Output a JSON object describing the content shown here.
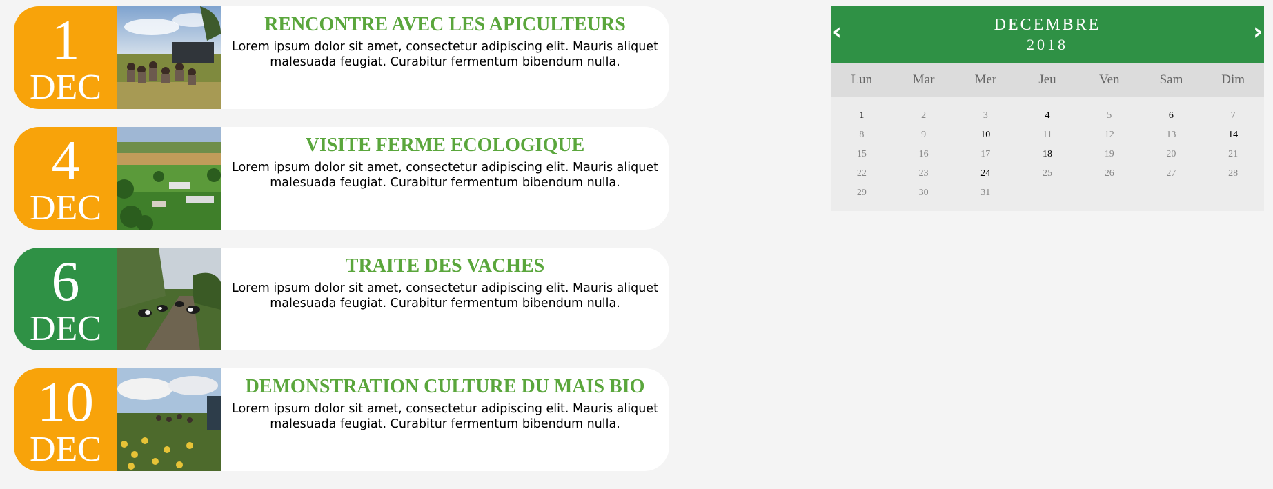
{
  "events": [
    {
      "day": "1",
      "month": "DEC",
      "badge_color": "orange",
      "title": "RENCONTRE AVEC LES APICULTEURS",
      "description": "Lorem ipsum dolor sit amet, consectetur adipiscing elit. Mauris aliquet malesuada feugiat. Curabitur fermentum bibendum nulla."
    },
    {
      "day": "4",
      "month": "DEC",
      "badge_color": "orange",
      "title": "VISITE FERME ECOLOGIQUE",
      "description": "Lorem ipsum dolor sit amet, consectetur adipiscing elit. Mauris aliquet malesuada feugiat. Curabitur fermentum bibendum nulla."
    },
    {
      "day": "6",
      "month": "DEC",
      "badge_color": "green",
      "title": "TRAITE DES VACHES",
      "description": "Lorem ipsum dolor sit amet, consectetur adipiscing elit. Mauris aliquet malesuada feugiat. Curabitur fermentum bibendum nulla."
    },
    {
      "day": "10",
      "month": "DEC",
      "badge_color": "orange",
      "title": "DEMONSTRATION CULTURE DU MAIS BIO",
      "description": "Lorem ipsum dolor sit amet, consectetur adipiscing elit. Mauris aliquet malesuada feugiat. Curabitur fermentum bibendum nulla."
    }
  ],
  "calendar": {
    "month": "DECEMBRE",
    "year": "2018",
    "prev_icon": "‹",
    "next_icon": "›",
    "weekdays": [
      "Lun",
      "Mar",
      "Mer",
      "Jeu",
      "Ven",
      "Sam",
      "Dim"
    ],
    "days": [
      "1",
      "2",
      "3",
      "4",
      "5",
      "6",
      "7",
      "8",
      "9",
      "10",
      "11",
      "12",
      "13",
      "14",
      "15",
      "16",
      "17",
      "18",
      "19",
      "20",
      "21",
      "22",
      "23",
      "24",
      "25",
      "26",
      "27",
      "28",
      "29",
      "30",
      "31"
    ],
    "event_days": [
      "1",
      "4",
      "6",
      "10",
      "14",
      "18",
      "24"
    ]
  },
  "colors": {
    "orange": "#f8a30a",
    "green": "#2f9145",
    "title_green": "#5aa63c",
    "background": "#f4f4f4"
  }
}
